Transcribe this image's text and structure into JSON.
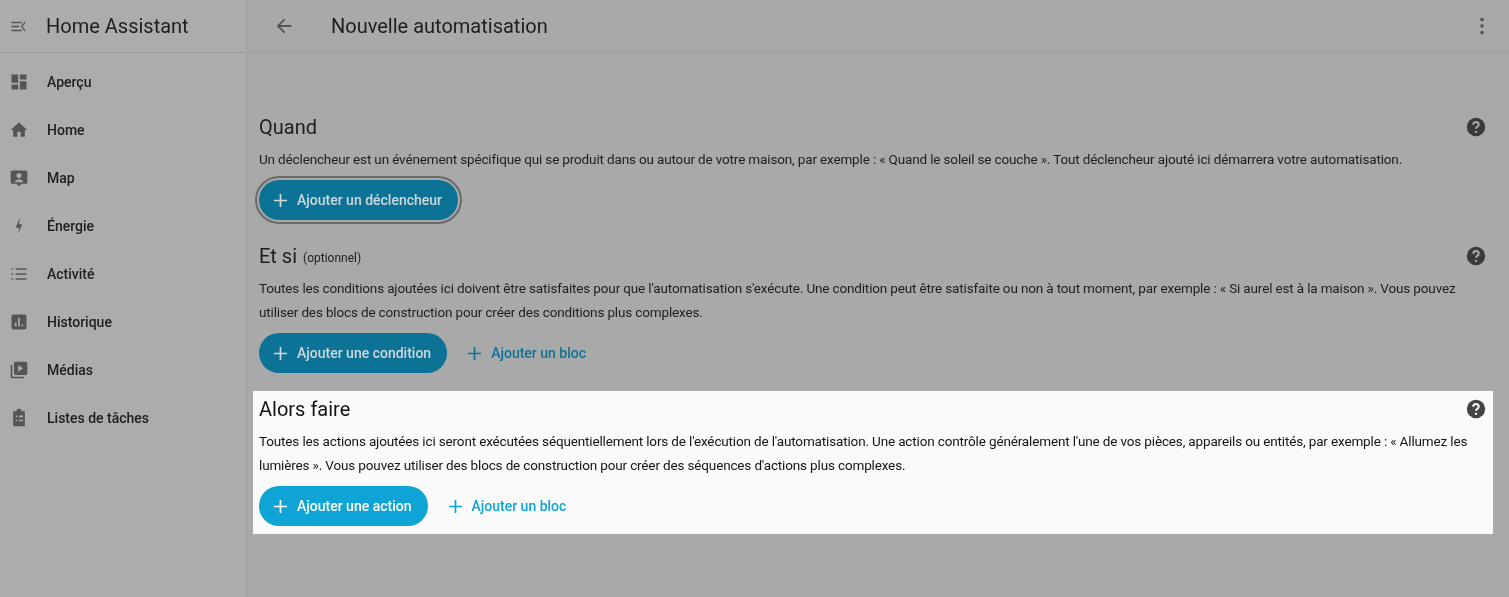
{
  "sidebar": {
    "title": "Home Assistant",
    "items": [
      {
        "label": "Aperçu"
      },
      {
        "label": "Home"
      },
      {
        "label": "Map"
      },
      {
        "label": "Énergie"
      },
      {
        "label": "Activité"
      },
      {
        "label": "Historique"
      },
      {
        "label": "Médias"
      },
      {
        "label": "Listes de tâches"
      }
    ]
  },
  "header": {
    "title": "Nouvelle automatisation"
  },
  "sections": [
    {
      "title": "Quand",
      "description": "Un déclencheur est un événement spécifique qui se produit dans ou autour de votre maison, par exemple : « Quand le soleil se couche ». Tout déclencheur ajouté ici démarrera votre automatisation.",
      "highlighted": false,
      "buttons": [
        {
          "kind": "primary",
          "label": "Ajouter un déclencheur",
          "focused": true
        }
      ]
    },
    {
      "title": "Et si",
      "subtitle": "(optionnel)",
      "description": "Toutes les conditions ajoutées ici doivent être satisfaites pour que l'automatisation s'exécute. Une condition peut être satisfaite ou non à tout moment, par exemple : « Si aurel est à la maison ». Vous pouvez utiliser des blocs de construction pour créer des conditions plus complexes.",
      "highlighted": false,
      "buttons": [
        {
          "kind": "primary",
          "label": "Ajouter une condition",
          "focused": false
        },
        {
          "kind": "link",
          "label": "Ajouter un bloc",
          "focused": false
        }
      ]
    },
    {
      "title": "Alors faire",
      "description": "Toutes les actions ajoutées ici seront exécutées séquentiellement lors de l'exécution de l'automatisation. Une action contrôle généralement l'une de vos pièces, appareils ou entités, par exemple : « Allumez les lumières ». Vous pouvez utiliser des blocs de construction pour créer des séquences d'actions plus complexes.",
      "highlighted": true,
      "buttons": [
        {
          "kind": "primary",
          "label": "Ajouter une action",
          "focused": false
        },
        {
          "kind": "link",
          "label": "Ajouter un bloc",
          "focused": false
        }
      ]
    }
  ]
}
